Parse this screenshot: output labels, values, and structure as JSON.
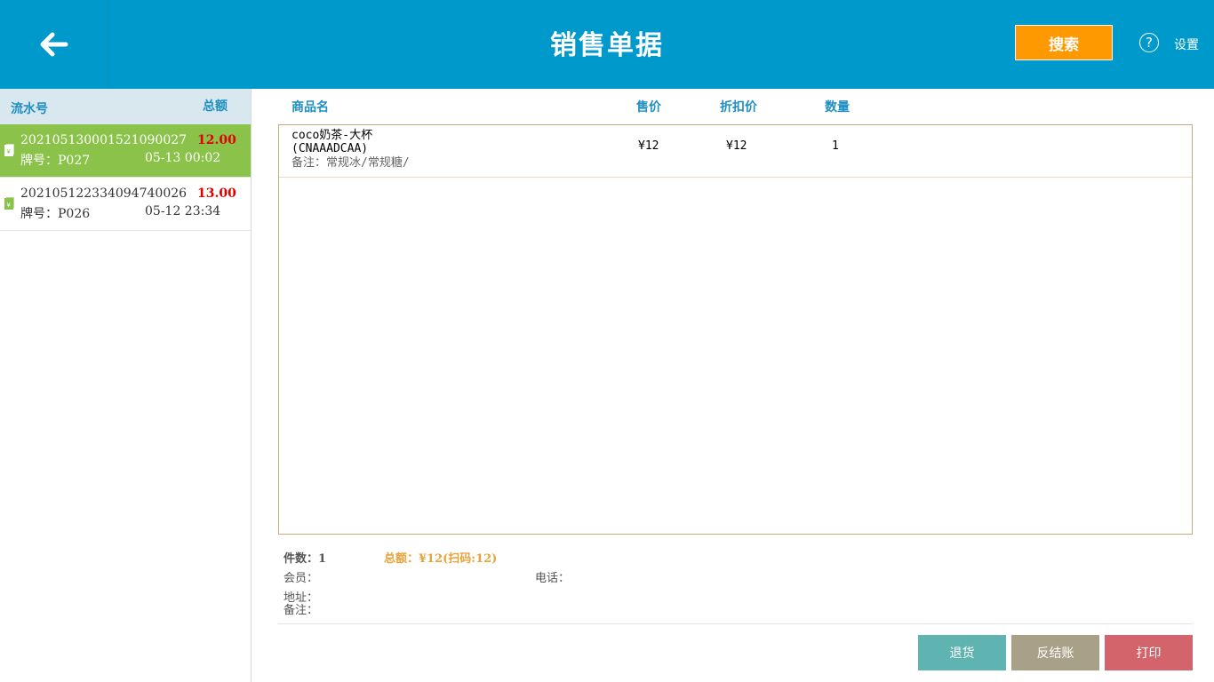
{
  "header": {
    "title": "销售单据",
    "search_label": "搜索",
    "help_glyph": "?",
    "settings_label": "设置"
  },
  "colors": {
    "header_bg": "#0099cc",
    "search_btn": "#ff9900",
    "selected_row": "#8bc34a",
    "amount_red": "#e00000",
    "total_orange": "#e8a33a",
    "btn_return": "#5fb3b1",
    "btn_unsettle": "#a8a087",
    "btn_print": "#d4646c"
  },
  "icons": {
    "back": "arrow-left-icon",
    "help": "help-circle-icon",
    "order": "receipt-icon"
  },
  "orders": {
    "header_serial": "流水号",
    "header_total": "总额",
    "list": [
      {
        "serial": "20210513000152109002​7",
        "amount": "12.00",
        "plate": "牌号：P027",
        "time": "05-13 00:02",
        "selected": true
      },
      {
        "serial": "202105122334094740026",
        "amount": "13.00",
        "plate": "牌号：P026",
        "time": "05-12 23:34",
        "selected": false
      }
    ]
  },
  "table": {
    "headers": {
      "name": "商品名",
      "price": "售价",
      "discount": "折扣价",
      "qty": "数量"
    },
    "rows": [
      {
        "name": "coco奶茶-大杯",
        "code": "(CNAAADCAA)",
        "note": "备注：常规冰/常规糖/",
        "price": "¥12",
        "discount": "¥12",
        "qty": "1"
      }
    ]
  },
  "summary": {
    "count": "件数：1",
    "total": "总额：¥12(扫码:12)",
    "member": "会员：",
    "phone": "电话：",
    "address": "地址：",
    "remark": "备注："
  },
  "actions": {
    "return_label": "退货",
    "unsettle_label": "反结账",
    "print_label": "打印"
  }
}
